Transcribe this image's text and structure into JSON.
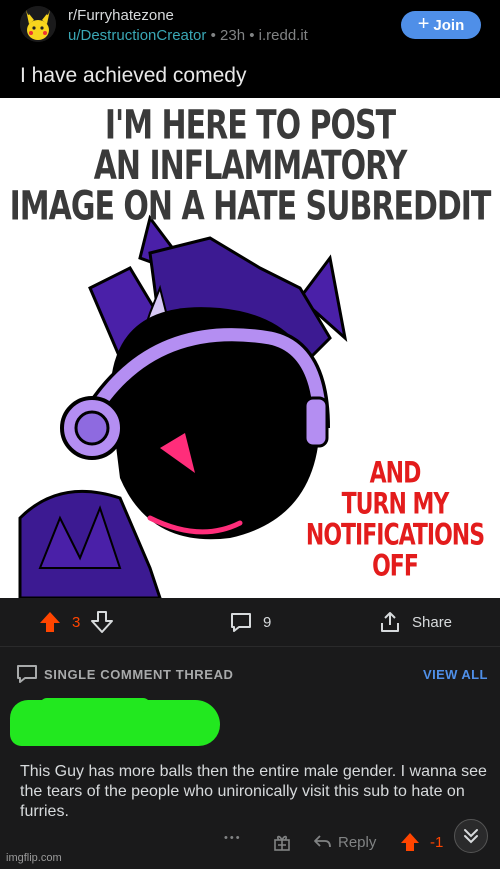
{
  "header": {
    "subreddit": "r/Furryhatezone",
    "username": "u/DestructionCreator",
    "age": "23h",
    "separator": "•",
    "domain": "i.redd.it",
    "join_label": "Join",
    "join_plus": "+",
    "avatar_icon": "pikachu-avatar-icon"
  },
  "post": {
    "title": "I have achieved comedy",
    "image": {
      "top_text": [
        "I'M HERE TO POST",
        "AN INFLAMMATORY",
        "IMAGE ON A HATE SUBREDDIT"
      ],
      "bottom_text": [
        "AND",
        "TURN MY",
        "NOTIFICATIONS",
        "OFF"
      ]
    }
  },
  "actions": {
    "upvote_count": "3",
    "comment_count": "9",
    "share_label": "Share"
  },
  "thread": {
    "label": "SINGLE COMMENT THREAD",
    "view_all": "VIEW ALL"
  },
  "comment": {
    "body": "This Guy has more balls then the entire male gender. I wanna see the tears of the people who unironically visit this sub to hate on furries.",
    "more": "•••",
    "reply_label": "Reply",
    "score": "-1"
  },
  "watermark": "imgflip.com",
  "colors": {
    "accent_blue": "#4f8fe8",
    "upvote_orange": "#ff4500",
    "username_teal": "#3aa7b5",
    "scribble_green": "#22e81f"
  }
}
